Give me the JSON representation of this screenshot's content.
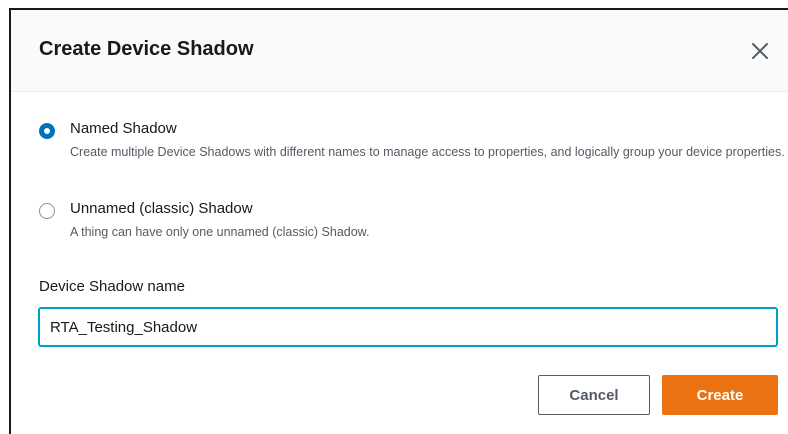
{
  "dialog": {
    "title": "Create Device Shadow",
    "close_icon": "close-icon"
  },
  "shadow_type": {
    "options": [
      {
        "label": "Named Shadow",
        "description": "Create multiple Device Shadows with different names to manage access to properties, and logically group your device properties.",
        "selected": true
      },
      {
        "label": "Unnamed (classic) Shadow",
        "description": "A thing can have only one unnamed (classic) Shadow.",
        "selected": false
      }
    ]
  },
  "shadow_name": {
    "label": "Device Shadow name",
    "value": "RTA_Testing_Shadow"
  },
  "actions": {
    "cancel_label": "Cancel",
    "create_label": "Create"
  },
  "colors": {
    "primary_orange": "#ec7211",
    "radio_blue": "#0073bb",
    "focus_border": "#00a1c9"
  }
}
